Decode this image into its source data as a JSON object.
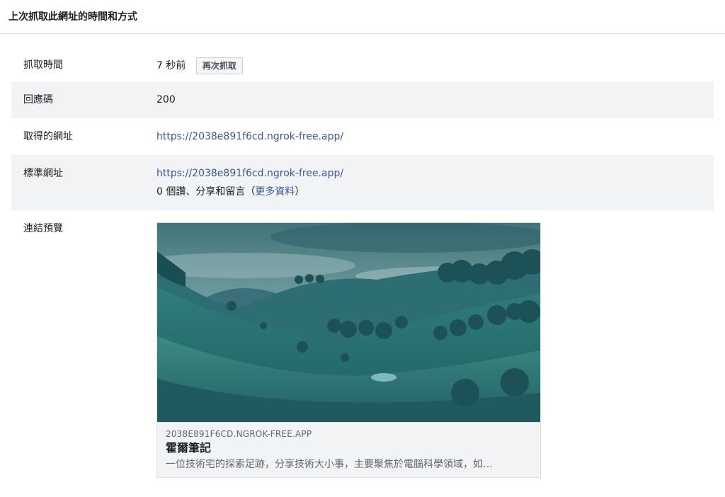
{
  "header": {
    "title": "上次抓取此網址的時間和方式"
  },
  "rows": {
    "fetch_time": {
      "label": "抓取時間",
      "value": "7 秒前",
      "button_label": "再次抓取"
    },
    "response_code": {
      "label": "回應碼",
      "value": "200"
    },
    "fetched_url": {
      "label": "取得的網址",
      "value": "https://2038e891f6cd.ngrok-free.app/"
    },
    "canonical_url": {
      "label": "標準網址",
      "value": "https://2038e891f6cd.ngrok-free.app/",
      "engagement_prefix": "0 個讚、分享和留言（",
      "engagement_link": "更多資料",
      "engagement_suffix": "）"
    },
    "link_preview": {
      "label": "連結預覽",
      "domain": "2038E891F6CD.NGROK-FREE.APP",
      "title": "霍爾筆記",
      "description": "一位技術宅的探索足跡，分享技術大小事，主要聚焦於電腦科學領域，如…"
    }
  },
  "colors": {
    "link": "#385898",
    "shaded_row": "#f2f3f5",
    "border": "#dddfe2"
  }
}
